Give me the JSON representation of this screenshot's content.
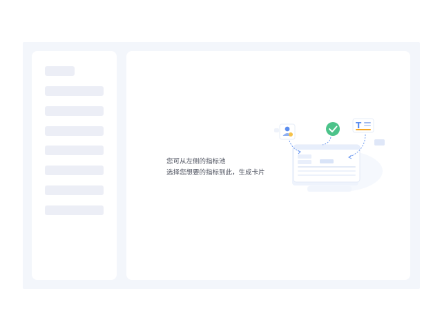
{
  "empty_state": {
    "line1": "您可从左侧的指标池",
    "line2": "选择您想要的指标到此，生成卡片",
    "illustration_icons": [
      "user-icon",
      "check-icon",
      "text-icon"
    ]
  },
  "colors": {
    "frame_bg": "#f3f6fb",
    "panel_bg": "#ffffff",
    "placeholder": "#eceef6",
    "accent_blue": "#5b8def",
    "accent_green": "#4cc38a",
    "accent_orange": "#f5a623"
  }
}
